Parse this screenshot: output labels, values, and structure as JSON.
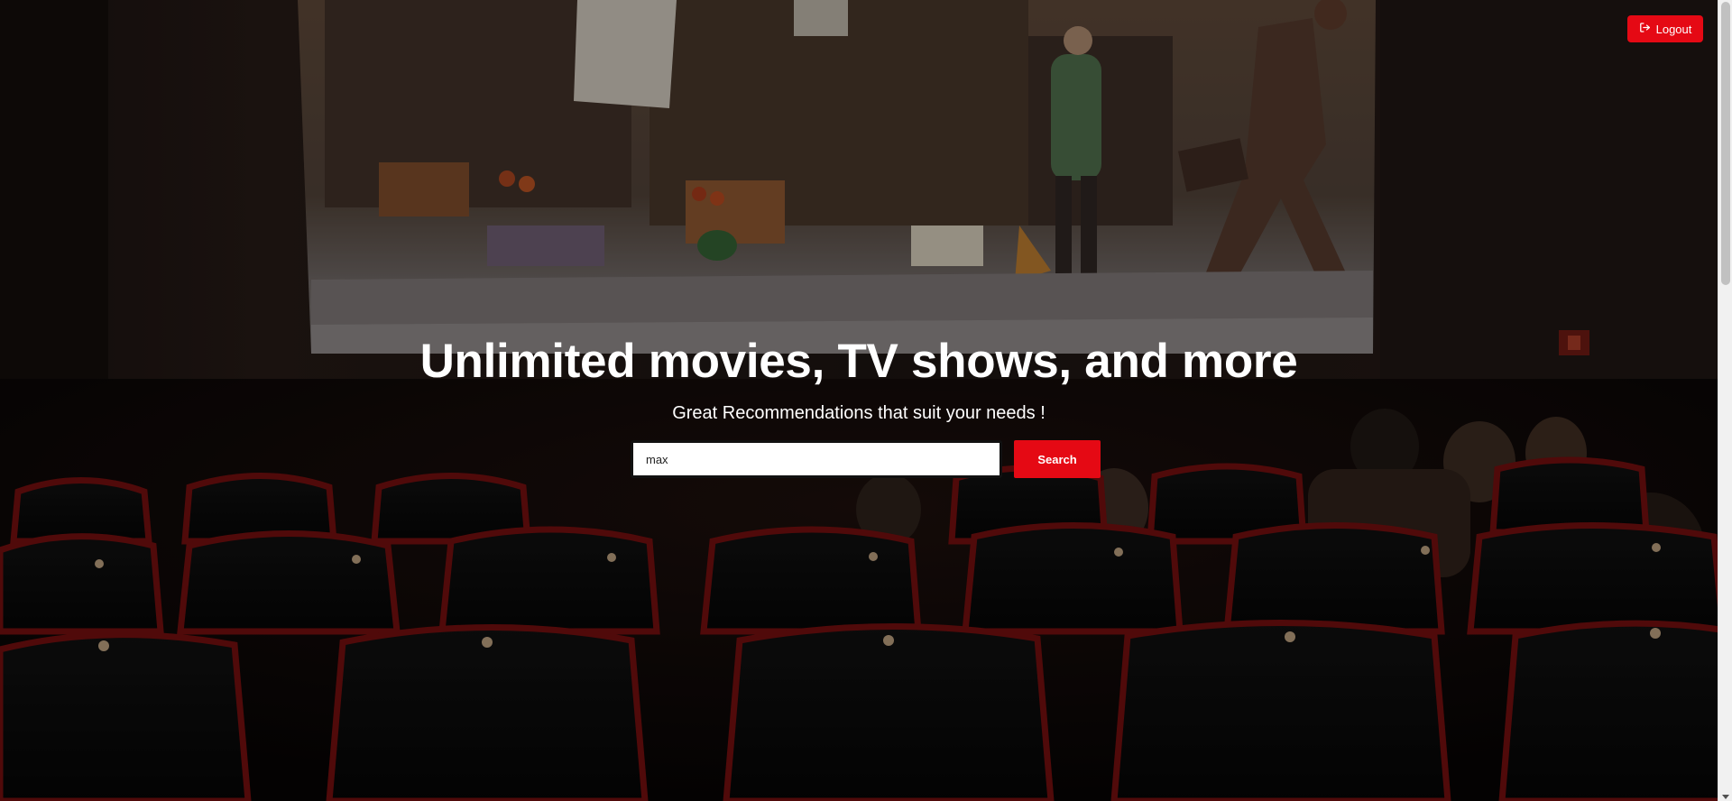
{
  "hero": {
    "title": "Unlimited movies, TV shows, and more",
    "subtitle": "Great Recommendations that suit your needs !"
  },
  "search": {
    "value": "max",
    "button_label": "Search"
  },
  "header": {
    "logout_label": "Logout",
    "logout_icon": "logout-icon"
  },
  "colors": {
    "accent": "#e50914",
    "text": "#ffffff"
  }
}
